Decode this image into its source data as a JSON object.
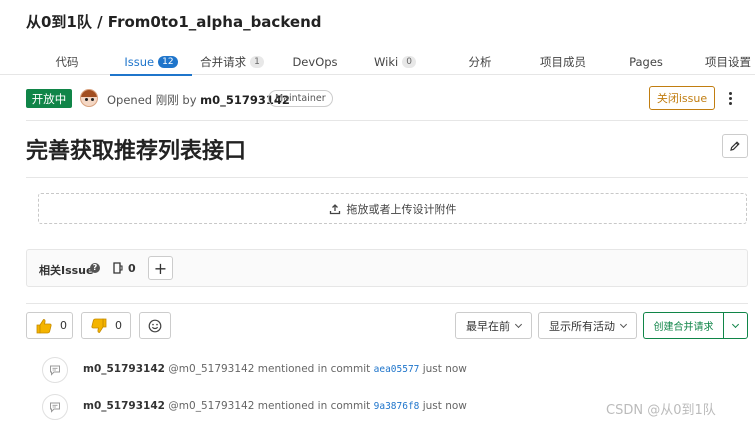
{
  "project": {
    "title": "从0到1队 / From0to1_alpha_backend"
  },
  "tabs": [
    {
      "label": "代码",
      "badge": null
    },
    {
      "label": "Issue",
      "badge": "12"
    },
    {
      "label": "合并请求",
      "badge": "1"
    },
    {
      "label": "DevOps",
      "badge": null
    },
    {
      "label": "Wiki",
      "badge": "0"
    },
    {
      "label": "分析",
      "badge": null
    },
    {
      "label": "项目成员",
      "badge": null
    },
    {
      "label": "Pages",
      "badge": null
    },
    {
      "label": "项目设置",
      "badge": null
    }
  ],
  "active_tab": "Issue",
  "issue": {
    "status": "开放中",
    "opened_prefix": "Opened 刚刚 by",
    "author": "m0_51793142",
    "role": "Maintainer",
    "close_label": "关闭issue",
    "title": "完善获取推荐列表接口"
  },
  "upload": {
    "label": "拖放或者上传设计附件"
  },
  "related": {
    "label": "相关Issue",
    "count": "0"
  },
  "awards": {
    "thumbs_up": "0",
    "thumbs_down": "0"
  },
  "sort": {
    "label": "最早在前"
  },
  "filter": {
    "label": "显示所有活动"
  },
  "merge_request": {
    "label": "创建合并请求"
  },
  "notes": [
    {
      "author": "m0_51793142",
      "handle": "@m0_51793142",
      "text": "mentioned in commit",
      "sha": "aea05577",
      "time": "just now"
    },
    {
      "author": "m0_51793142",
      "handle": "@m0_51793142",
      "text": "mentioned in commit",
      "sha": "9a3876f8",
      "time": "just now"
    }
  ],
  "watermark": "CSDN @从0到1队",
  "colors": {
    "accent": "#1f75cb",
    "success": "#108548",
    "warning": "#c17d10"
  }
}
